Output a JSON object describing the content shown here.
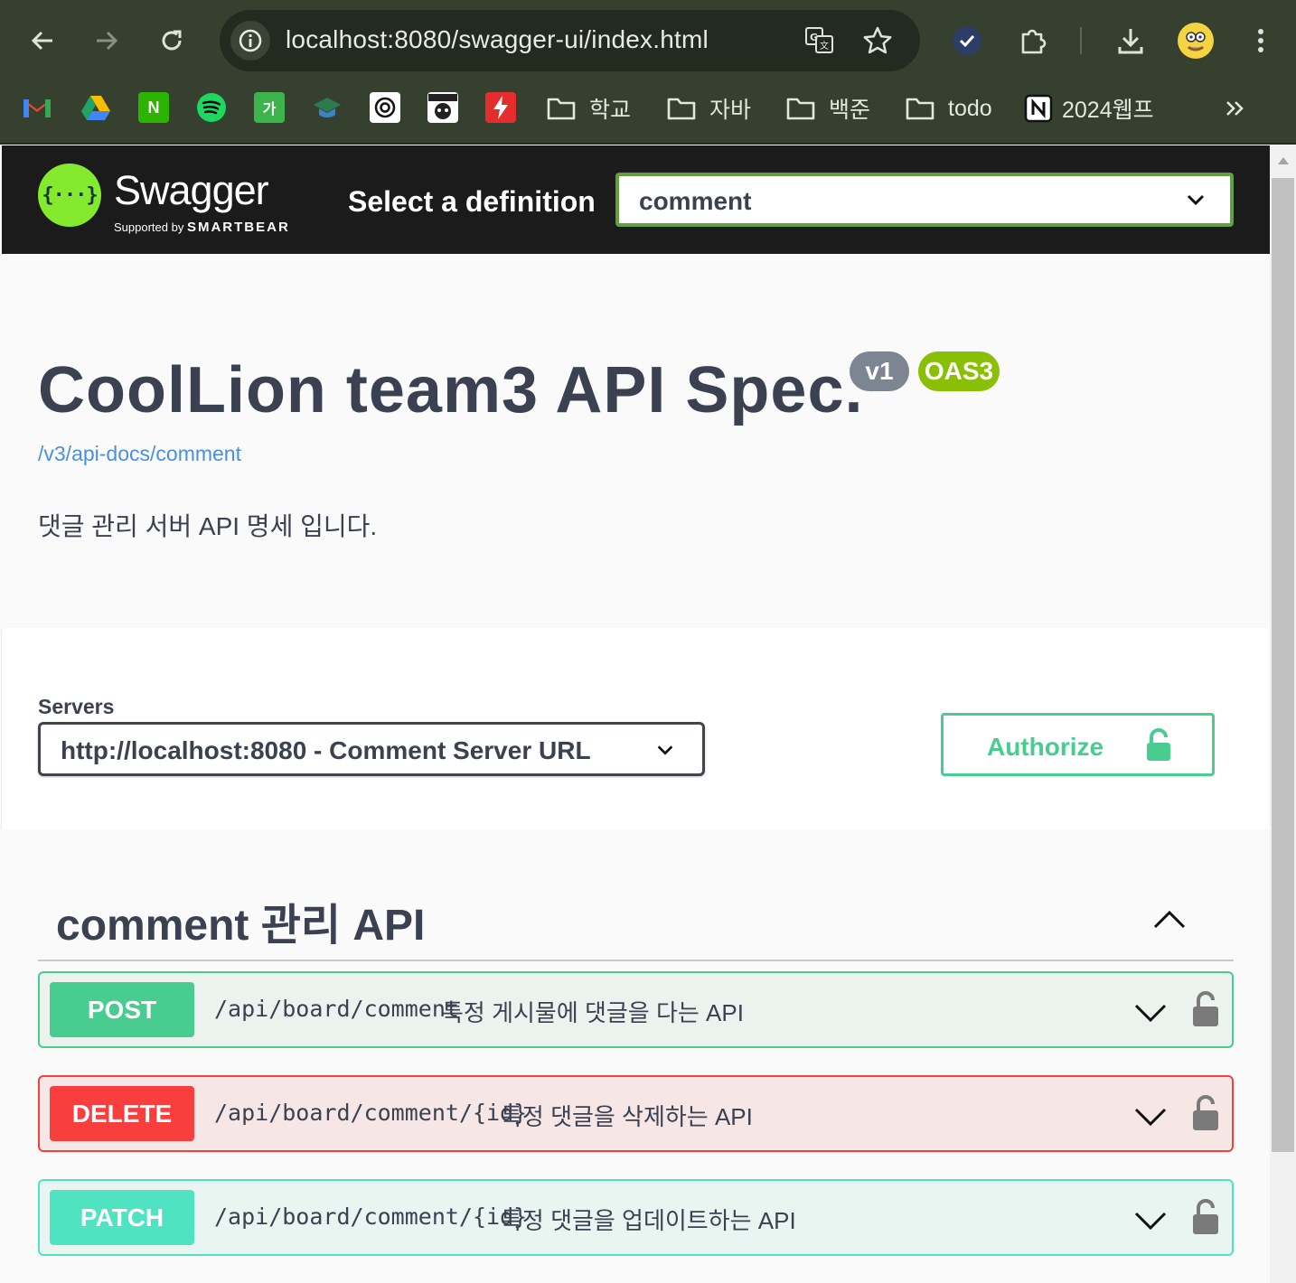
{
  "browser": {
    "url": "localhost:8080/swagger-ui/index.html",
    "bookmarks": [
      {
        "name": "gmail-bookmark",
        "icon": "gmail-icon",
        "color": "#ea4335"
      },
      {
        "name": "drive-bookmark",
        "icon": "google-drive-icon",
        "color": "#1fa463"
      },
      {
        "name": "naver-bookmark",
        "icon": "naver-icon",
        "glyph": "N",
        "color": "#2db400"
      },
      {
        "name": "spotify-bookmark",
        "icon": "spotify-icon",
        "color": "#1ed760"
      },
      {
        "name": "hangul-bookmark",
        "icon": "hangul-icon",
        "glyph": "가",
        "color": "#3cb44b"
      },
      {
        "name": "edu-bookmark",
        "icon": "graduation-cap-icon",
        "color": "#2d7a4f"
      },
      {
        "name": "target-bookmark",
        "icon": "target-icon",
        "color": "#ffffff"
      },
      {
        "name": "cat-bookmark",
        "icon": "cat-icon",
        "color": "#ffffff"
      },
      {
        "name": "flash-bookmark",
        "icon": "lightning-icon",
        "color": "#e52d2d"
      }
    ],
    "folders": [
      {
        "label": "학교"
      },
      {
        "label": "자바"
      },
      {
        "label": "백준"
      },
      {
        "label": "todo"
      }
    ],
    "notion_bookmark": "2024웹프"
  },
  "topbar": {
    "logo_text": "Swagger",
    "logo_sub": "Supported by",
    "logo_sub_brand": "SMARTBEAR",
    "logo_glyph": "{···}",
    "definition_label": "Select a definition",
    "definition_value": "comment"
  },
  "info": {
    "title": "CoolLion team3 API Spec.",
    "version_badge": "v1",
    "oas_badge": "OAS3",
    "spec_url": "/v3/api-docs/comment",
    "description": "댓글 관리 서버 API 명세 입니다."
  },
  "scheme": {
    "servers_label": "Servers",
    "server_value": "http://localhost:8080 - Comment Server URL",
    "authorize_label": "Authorize"
  },
  "operations": {
    "tag": "comment 관리 API",
    "items": [
      {
        "method": "POST",
        "path": "/api/board/comment",
        "summary": "특정 게시물에 댓글을 다는 API",
        "color": "#49cc90"
      },
      {
        "method": "DELETE",
        "path": "/api/board/comment/{id}",
        "summary": "특정 댓글을 삭제하는 API",
        "color": "#f93e3e"
      },
      {
        "method": "PATCH",
        "path": "/api/board/comment/{id}",
        "summary": "특정 댓글을 업데이트하는 API",
        "color": "#50e3c2"
      }
    ]
  },
  "colors": {
    "swagger_green": "#85ea2d",
    "topbar_bg": "#1b1b1b",
    "select_border": "#62a03f",
    "authorize": "#49cc90",
    "text": "#3b4151",
    "link": "#4990e2",
    "version_badge": "#7d8492",
    "oas_badge": "#89bf04"
  }
}
